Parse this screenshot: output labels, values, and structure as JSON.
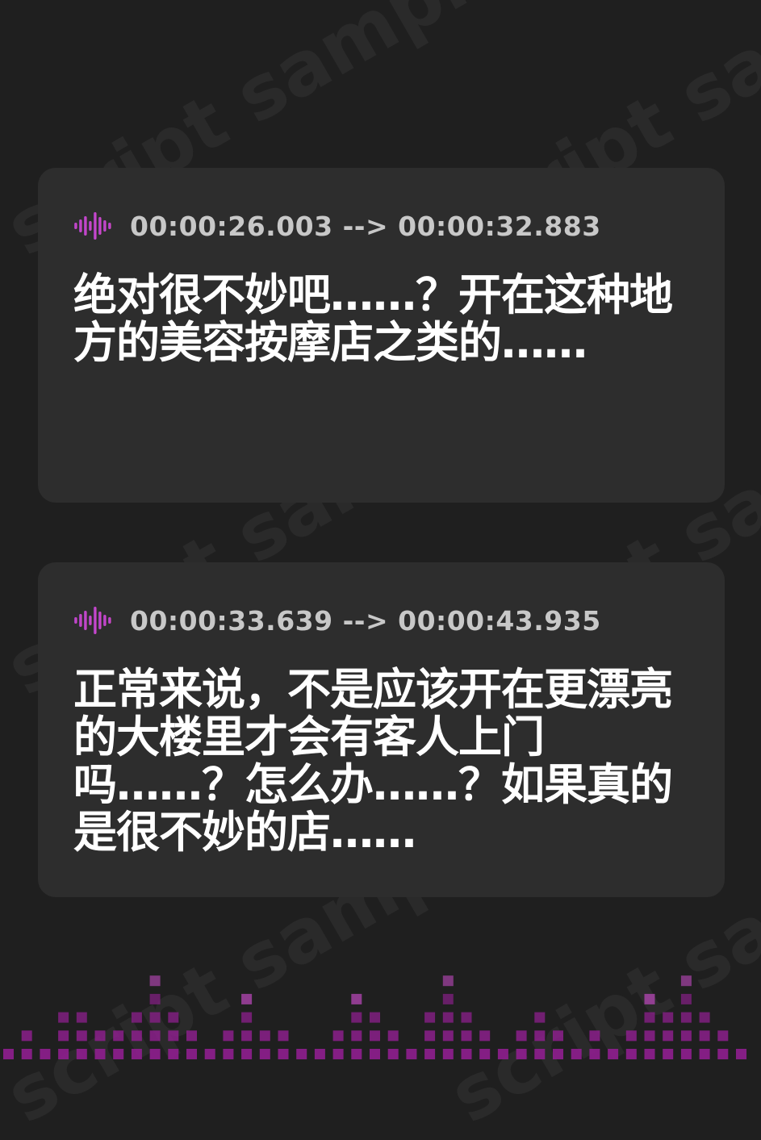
{
  "watermark": "script sample",
  "subtitles": [
    {
      "timestamp": "00:00:26.003 --> 00:00:32.883",
      "text": "绝对很不妙吧……？开在这种地方的美容按摩店之类的……"
    },
    {
      "timestamp": "00:00:33.639 --> 00:00:43.935",
      "text": "正常来说，不是应该开在更漂亮的大楼里才会有客人上门吗……？怎么办……？如果真的是很不妙的店……"
    }
  ],
  "icons": {
    "subtitle_icon": "audio-wave-icon"
  },
  "colors": {
    "background": "#1f1f1f",
    "card": "#2d2d2d",
    "accent_purple": "#b040c0",
    "accent_magenta": "#e040d0",
    "timestamp": "#c8c8c8",
    "text": "#ffffff"
  }
}
